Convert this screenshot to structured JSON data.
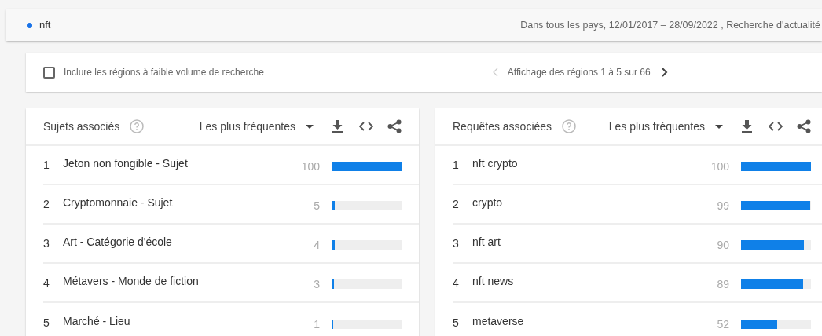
{
  "search_bar": {
    "term": "nft",
    "summary": "Dans tous les pays, 12/01/2017 – 28/09/2022 , Recherche d'actualité"
  },
  "region_options": {
    "low_volume_checkbox": {
      "label": "Inclure les régions à faible volume de recherche",
      "checked": false
    },
    "pagination": {
      "prev_disabled": true,
      "text": "Affichage des régions 1 à 5 sur 66",
      "next_disabled": false
    }
  },
  "panels": [
    {
      "title": "Sujets associés",
      "sort": "Les plus fréquentes",
      "rows": [
        {
          "rank": "1",
          "label": "Jeton non fongible - Sujet",
          "value": "100",
          "level": 1.0
        },
        {
          "rank": "2",
          "label": "Cryptomonnaie - Sujet",
          "value": "5",
          "level": 0.05
        },
        {
          "rank": "3",
          "label": "Art - Catégorie d'école",
          "value": "4",
          "level": 0.04
        },
        {
          "rank": "4",
          "label": "Métavers - Monde de fiction",
          "value": "3",
          "level": 0.03
        },
        {
          "rank": "5",
          "label": "Marché - Lieu",
          "value": "1",
          "level": 0.01
        }
      ]
    },
    {
      "title": "Requêtes associées",
      "sort": "Les plus fréquentes",
      "rows": [
        {
          "rank": "1",
          "label": "nft crypto",
          "value": "100",
          "level": 1.0
        },
        {
          "rank": "2",
          "label": "crypto",
          "value": "99",
          "level": 0.99
        },
        {
          "rank": "3",
          "label": "nft art",
          "value": "90",
          "level": 0.9
        },
        {
          "rank": "4",
          "label": "nft news",
          "value": "89",
          "level": 0.89
        },
        {
          "rank": "5",
          "label": "metaverse",
          "value": "52",
          "level": 0.52
        }
      ]
    }
  ]
}
